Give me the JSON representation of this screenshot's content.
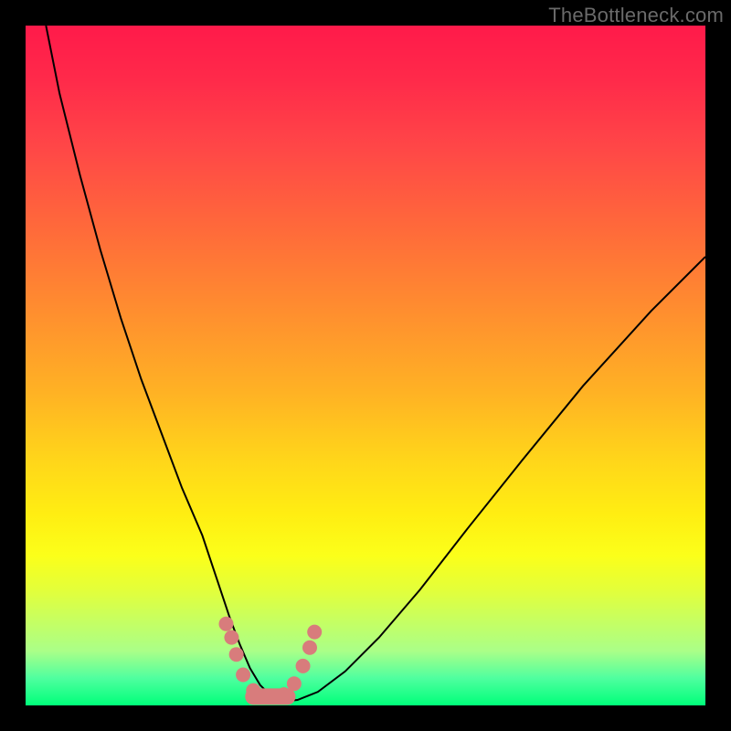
{
  "watermark": "TheBottleneck.com",
  "frame": {
    "outer_color": "#000000",
    "inner_left": 28,
    "inner_top": 28,
    "inner_w": 744,
    "inner_h": 744
  },
  "gradient_stops": [
    {
      "pct": 0,
      "color": "#ff1a4a"
    },
    {
      "pct": 18,
      "color": "#ff4747"
    },
    {
      "pct": 42,
      "color": "#ff8e2f"
    },
    {
      "pct": 64,
      "color": "#ffd61a"
    },
    {
      "pct": 83,
      "color": "#e3ff3a"
    },
    {
      "pct": 100,
      "color": "#00ff7a"
    }
  ],
  "chart_data": {
    "type": "line",
    "title": "",
    "xlabel": "",
    "ylabel": "",
    "xlim": [
      0,
      100
    ],
    "ylim": [
      0,
      100
    ],
    "grid": false,
    "legend": false,
    "series": [
      {
        "name": "bottleneck-curve",
        "stroke": "#000000",
        "stroke_width": 2,
        "x": [
          3,
          5,
          8,
          11,
          14,
          17,
          20,
          23,
          26,
          28,
          30,
          31.5,
          33,
          34.5,
          36,
          37,
          38,
          40,
          43,
          47,
          52,
          58,
          65,
          73,
          82,
          92,
          100
        ],
        "y": [
          100,
          90,
          78,
          67,
          57,
          48,
          40,
          32,
          25,
          19,
          13,
          9,
          5.5,
          3,
          1.5,
          0.8,
          0.6,
          0.8,
          2,
          5,
          10,
          17,
          26,
          36,
          47,
          58,
          66
        ]
      },
      {
        "name": "marker-dots",
        "type": "scatter",
        "marker_color": "#d87c7c",
        "marker_radius_px": 8,
        "x": [
          29.5,
          30.3,
          31.0,
          32.0,
          33.5,
          35.0,
          36.5,
          38.0,
          39.5,
          40.8,
          41.8,
          42.5
        ],
        "y": [
          12.0,
          10.0,
          7.5,
          4.5,
          2.2,
          1.3,
          1.2,
          1.6,
          3.2,
          5.8,
          8.5,
          10.8
        ]
      },
      {
        "name": "marker-bar",
        "type": "line",
        "stroke": "#d87c7c",
        "stroke_width_px": 18,
        "linecap": "round",
        "x": [
          33.5,
          38.5
        ],
        "y": [
          1.3,
          1.3
        ]
      }
    ]
  }
}
